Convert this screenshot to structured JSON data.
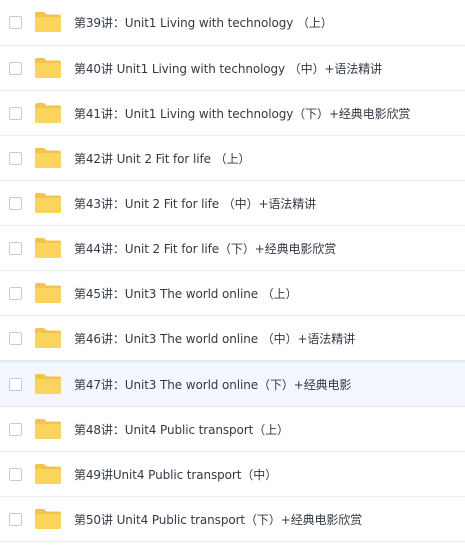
{
  "colors": {
    "folder_back": "#f2c44a",
    "folder_front": "#fbd45e",
    "row_hover_bg": "#f3f7fd"
  },
  "icons": {
    "row_checkbox": "checkbox-icon",
    "row_icon": "folder-icon"
  },
  "files": [
    {
      "name": "第39讲：Unit1 Living with technology （上）"
    },
    {
      "name": "第40讲 Unit1 Living with technology （中）+语法精讲"
    },
    {
      "name": "第41讲：Unit1 Living with technology（下）+经典电影欣赏"
    },
    {
      "name": "第42讲 Unit 2 Fit for life （上）"
    },
    {
      "name": "第43讲：Unit 2 Fit for life （中）+语法精讲"
    },
    {
      "name": "第44讲：Unit 2 Fit for life（下）+经典电影欣赏"
    },
    {
      "name": "第45讲：Unit3 The world online （上）"
    },
    {
      "name": "第46讲：Unit3 The world online （中）+语法精讲"
    },
    {
      "name": "第47讲：Unit3 The world online（下）+经典电影"
    },
    {
      "name": "第48讲：Unit4 Public transport（上）"
    },
    {
      "name": "第49讲Unit4 Public transport（中）"
    },
    {
      "name": "第50讲 Unit4 Public transport（下）+经典电影欣赏"
    }
  ]
}
